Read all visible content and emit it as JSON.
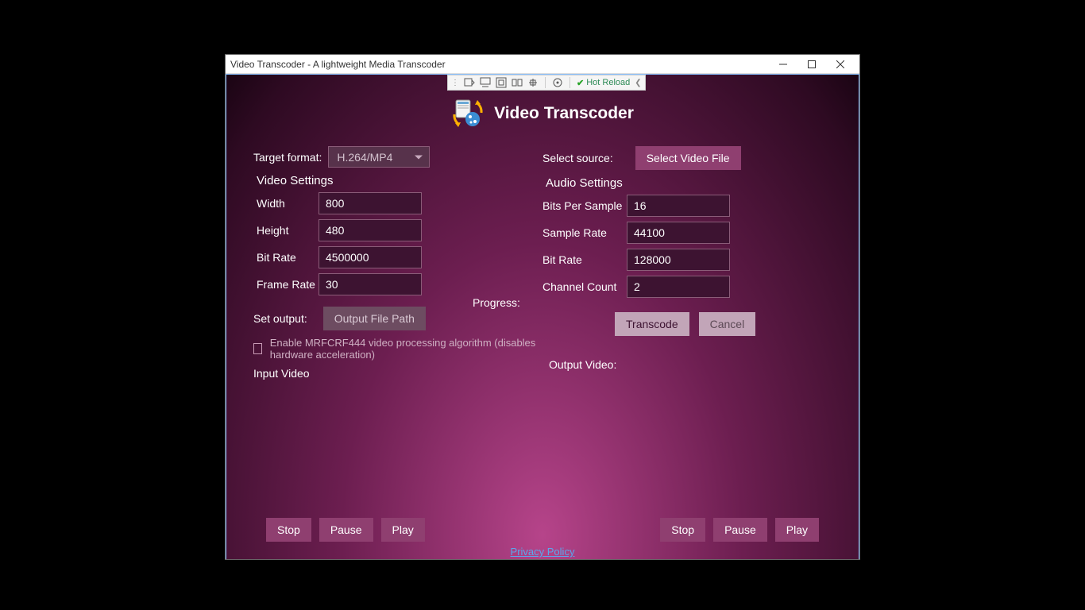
{
  "window": {
    "title": "Video Transcoder - A lightweight Media Transcoder"
  },
  "debugbar": {
    "hot_reload": "Hot Reload"
  },
  "app": {
    "title": "Video Transcoder"
  },
  "left": {
    "target_format_label": "Target format:",
    "target_format_value": "H.264/MP4",
    "video_settings": "Video Settings",
    "width_label": "Width",
    "width_value": "800",
    "height_label": "Height",
    "height_value": "480",
    "bitrate_label": "Bit Rate",
    "bitrate_value": "4500000",
    "framerate_label": "Frame Rate",
    "framerate_value": "30",
    "set_output_label": "Set output:",
    "output_btn": "Output File Path",
    "mrf_label": "Enable MRFCRF444 video processing algorithm (disables hardware acceleration)",
    "input_video": "Input Video"
  },
  "right": {
    "select_source_label": "Select source:",
    "select_video_btn": "Select Video File",
    "audio_settings": "Audio Settings",
    "bps_label": "Bits Per Sample",
    "bps_value": "16",
    "sample_rate_label": "Sample Rate",
    "sample_rate_value": "44100",
    "abitrate_label": "Bit Rate",
    "abitrate_value": "128000",
    "channels_label": "Channel Count",
    "channels_value": "2",
    "transcode": "Transcode",
    "cancel": "Cancel",
    "output_video": "Output Video:"
  },
  "progress_label": "Progress:",
  "buttons": {
    "stop": "Stop",
    "pause": "Pause",
    "play": "Play"
  },
  "privacy": "Privacy Policy"
}
